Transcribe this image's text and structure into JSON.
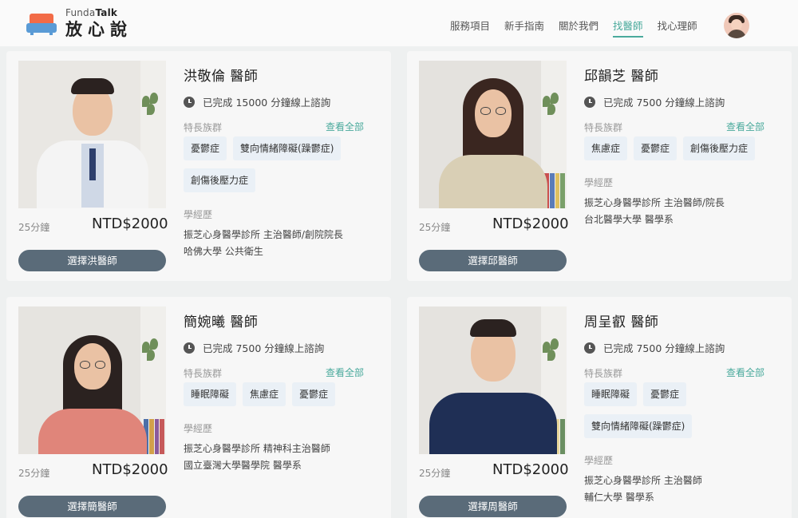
{
  "header": {
    "brand_en_prefix": "Funda",
    "brand_en_bold": "Talk",
    "brand_zh": "放心說",
    "nav": [
      {
        "label": "服務項目",
        "active": false
      },
      {
        "label": "新手指南",
        "active": false
      },
      {
        "label": "關於我們",
        "active": false
      },
      {
        "label": "找醫師",
        "active": true
      },
      {
        "label": "找心理師",
        "active": false
      }
    ]
  },
  "labels": {
    "specialty": "特長族群",
    "see_all": "查看全部",
    "education": "學經歷"
  },
  "colors": {
    "accent": "#4aaa9c",
    "button": "#5a6b79",
    "tag_bg": "#eaf0f6"
  },
  "doctors": [
    {
      "name": "洪敬倫 醫師",
      "consult": "已完成 15000 分鐘線上諮詢",
      "tags": [
        "憂鬱症",
        "雙向情緒障礙(躁鬱症)",
        "創傷後壓力症"
      ],
      "education": [
        "振芝心身醫學診所  主治醫師/創院院長",
        "哈佛大學  公共衛生"
      ],
      "duration": "25分鐘",
      "price": "NTD$2000",
      "button": "選擇洪醫師"
    },
    {
      "name": "邱韻芝 醫師",
      "consult": "已完成 7500 分鐘線上諮詢",
      "tags": [
        "焦慮症",
        "憂鬱症",
        "創傷後壓力症"
      ],
      "education": [
        "振芝心身醫學診所  主治醫師/院長",
        "台北醫學大學  醫學系"
      ],
      "duration": "25分鐘",
      "price": "NTD$2000",
      "button": "選擇邱醫師"
    },
    {
      "name": "簡婉曦 醫師",
      "consult": "已完成 7500 分鐘線上諮詢",
      "tags": [
        "睡眠障礙",
        "焦慮症",
        "憂鬱症"
      ],
      "education": [
        "振芝心身醫學診所  精神科主治醫師",
        "國立臺灣大學醫學院  醫學系"
      ],
      "duration": "25分鐘",
      "price": "NTD$2000",
      "button": "選擇簡醫師"
    },
    {
      "name": "周呈叡 醫師",
      "consult": "已完成 7500 分鐘線上諮詢",
      "tags": [
        "睡眠障礙",
        "憂鬱症",
        "雙向情緒障礙(躁鬱症)"
      ],
      "education": [
        "振芝心身醫學診所  主治醫師",
        "輔仁大學  醫學系"
      ],
      "duration": "25分鐘",
      "price": "NTD$2000",
      "button": "選擇周醫師"
    }
  ]
}
